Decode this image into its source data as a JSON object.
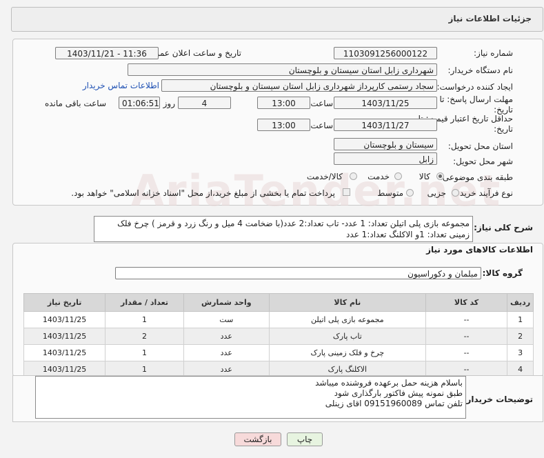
{
  "header": {
    "title": "جزئیات اطلاعات نیاز"
  },
  "watermark": "AriaTender.net",
  "form": {
    "need_number_label": "شماره نیاز:",
    "need_number": "1103091256000122",
    "announce_label": "تاریخ و ساعت اعلان عمومی:",
    "announce_value": "1403/11/21 - 11:36",
    "buyer_org_label": "نام دستگاه خریدار:",
    "buyer_org": "شهرداری زابل استان سیستان و بلوچستان",
    "requester_label": "ایجاد کننده درخواست:",
    "requester": "سجاد رستمی کارپرداز شهرداری زابل استان سیستان و بلوچستان",
    "contact_link": "اطلاعات تماس خریدار",
    "deadline_label": "مهلت ارسال پاسخ: تا تاریخ:",
    "deadline_date": "1403/11/25",
    "time_label": "ساعت",
    "deadline_time": "13:00",
    "days_value": "4",
    "days_label": "روز و",
    "remaining_time": "01:06:51",
    "remaining_label": "ساعت باقی مانده",
    "price_valid_label": "حداقل تاریخ اعتبار قیمت: تا تاریخ:",
    "price_valid_date": "1403/11/27",
    "price_valid_time": "13:00",
    "province_label": "استان محل تحویل:",
    "province": "سیستان و بلوچستان",
    "city_label": "شهر محل تحویل:",
    "city": "زابل",
    "category_label": "طبقه بندی موضوعی:",
    "category_options": [
      "کالا",
      "خدمت",
      "کالا/خدمت"
    ],
    "process_label": "نوع فرآیند خرید :",
    "process_options": [
      "جزیی",
      "متوسط"
    ],
    "payment_note": "پرداخت تمام یا بخشی از مبلغ خرید،از محل \"اسناد خزانه اسلامی\" خواهد بود."
  },
  "description": {
    "label": "شرح کلی نیاز:",
    "text": "مجموعه بازی پلی اتیلن تعداد: 1 عدد- تاب  تعداد:2 عدد(با ضخامت 4 میل و رنگ زرد و قرمز ) چرخ فلک زمینی تعداد: 1و  الاکلنگ تعداد:1 عدد"
  },
  "goods": {
    "section_title": "اطلاعات کالاهای مورد نیاز",
    "group_label": "گروه کالا:",
    "group_value": "مبلمان و دکوراسیون",
    "columns": [
      "ردیف",
      "کد کالا",
      "نام کالا",
      "واحد شمارش",
      "تعداد / مقدار",
      "تاریخ نیاز"
    ],
    "rows": [
      [
        "1",
        "--",
        "مجموعه بازی پلی اتیلن",
        "ست",
        "1",
        "1403/11/25"
      ],
      [
        "2",
        "--",
        "تاب پارک",
        "عدد",
        "2",
        "1403/11/25"
      ],
      [
        "3",
        "--",
        "چرخ و فلک زمینی پارک",
        "عدد",
        "1",
        "1403/11/25"
      ],
      [
        "4",
        "--",
        "الاکلنگ پارک",
        "عدد",
        "1",
        "1403/11/25"
      ]
    ]
  },
  "buyer_notes": {
    "label": "توضیحات خریدار:",
    "lines": [
      "باسلام هزینه حمل برعهده فروشنده میباشد",
      "طبق نمونه پیش فاکتور بارگذاری شود",
      "تلفن تماس 09151960089 اقای زینلی"
    ]
  },
  "buttons": {
    "print": "چاپ",
    "back": "بازگشت"
  },
  "colors": {
    "print_bg": "#e7f4e0",
    "back_bg": "#f7dada",
    "link": "#1d4fb3"
  }
}
